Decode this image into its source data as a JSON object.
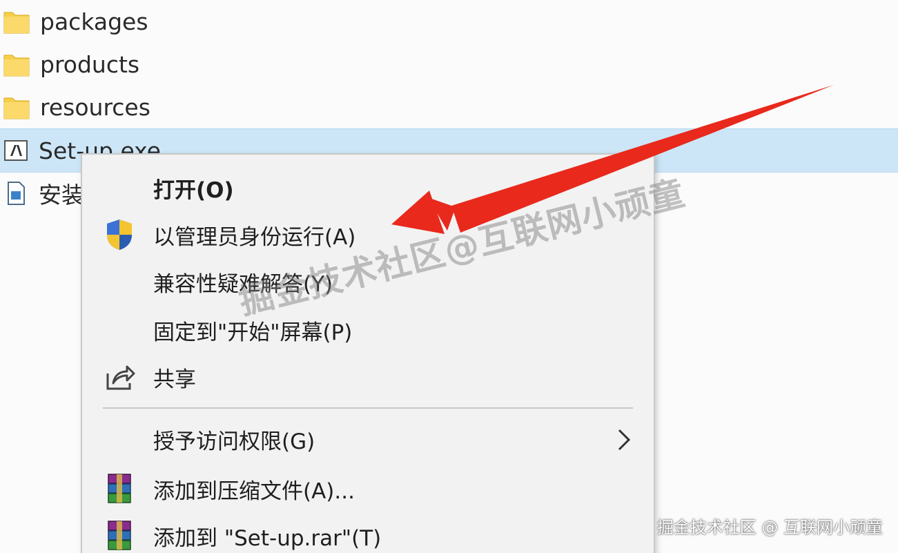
{
  "files": [
    {
      "name": "packages",
      "icon": "folder-icon"
    },
    {
      "name": "products",
      "icon": "folder-icon"
    },
    {
      "name": "resources",
      "icon": "folder-icon"
    },
    {
      "name": "Set-up.exe",
      "icon": "adobe-exe-icon"
    },
    {
      "name": "安装",
      "icon": "document-icon"
    }
  ],
  "context_menu": {
    "items": [
      {
        "label": "打开(O)",
        "icon": ""
      },
      {
        "label": "以管理员身份运行(A)",
        "icon": "uac-shield-icon"
      },
      {
        "label": "兼容性疑难解答(Y)",
        "icon": ""
      },
      {
        "label": "固定到\"开始\"屏幕(P)",
        "icon": ""
      },
      {
        "label": "共享",
        "icon": "share-icon"
      },
      {
        "label": "授予访问权限(G)",
        "icon": "",
        "submenu": true
      },
      {
        "label": "添加到压缩文件(A)...",
        "icon": "winrar-icon"
      },
      {
        "label": "添加到 \"Set-up.rar\"(T)",
        "icon": "winrar-icon"
      }
    ]
  },
  "watermark": {
    "diagonal": "掘金技术社区@互联网小顽童",
    "corner": "掘金技术社区 @ 互联网小顽童"
  },
  "colors": {
    "selection": "#cde6f7",
    "arrow": "#e8291c",
    "menu_bg": "#f2f2f2",
    "folder": "#f5c518"
  }
}
